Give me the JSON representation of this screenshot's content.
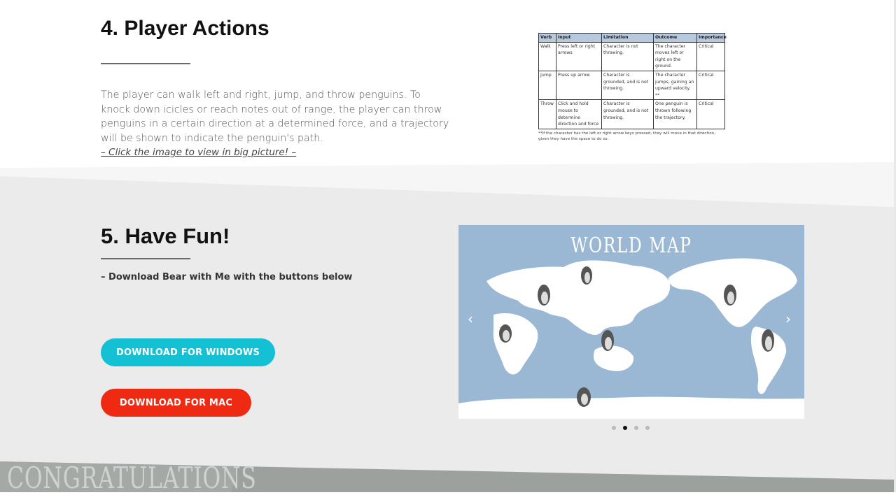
{
  "player_actions": {
    "heading": "4. Player Actions",
    "paragraph": "The player can walk left and right, jump, and throw penguins. To knock down icicles or reach notes out of range, the player can throw penguins in a certain direction at a determined force, and a trajectory will be shown to indicate the penguin's path.",
    "link_text": "– Click the image to view in big picture! –",
    "table": {
      "headers": [
        "Verb",
        "Input",
        "Limitation",
        "Outcome",
        "Importance"
      ],
      "rows": [
        [
          "Walk",
          "Press left or right arrows",
          "Character is not throwing.",
          "The character moves left or right on the ground.",
          "Critical"
        ],
        [
          "Jump",
          "Press up arrow",
          "Character is grounded, and is not throwing.",
          "The character jumps, gaining an upward velocity. **",
          "Critical"
        ],
        [
          "Throw",
          "Click and hold mouse to determine direction and force",
          "Character is grounded, and is not throwing.",
          "One penguin is thrown following the trajectory.",
          "Critical"
        ]
      ],
      "note": "**If the character has the left or right arrow keys pressed, they will move in that direction, given they have the space to do so."
    }
  },
  "have_fun": {
    "heading": "5. Have Fun!",
    "subtitle": "– Download Bear with Me with the buttons below",
    "windows_button": "DOWNLOAD FOR WINDOWS",
    "mac_button": "DOWNLOAD FOR MAC",
    "slider": {
      "title": "WORLD MAP",
      "prev_icon": "chevron-left-icon",
      "next_icon": "chevron-right-icon",
      "slide_count": 4,
      "active_slide": 2
    }
  },
  "next_section_title": "CONGRATULATIONS",
  "colors": {
    "windows_button": "#14c0d3",
    "mac_button": "#ee2a12",
    "section_bg": "#ebebeb",
    "map_ocean": "#9ab7d4",
    "table_header": "#b8c9de"
  }
}
